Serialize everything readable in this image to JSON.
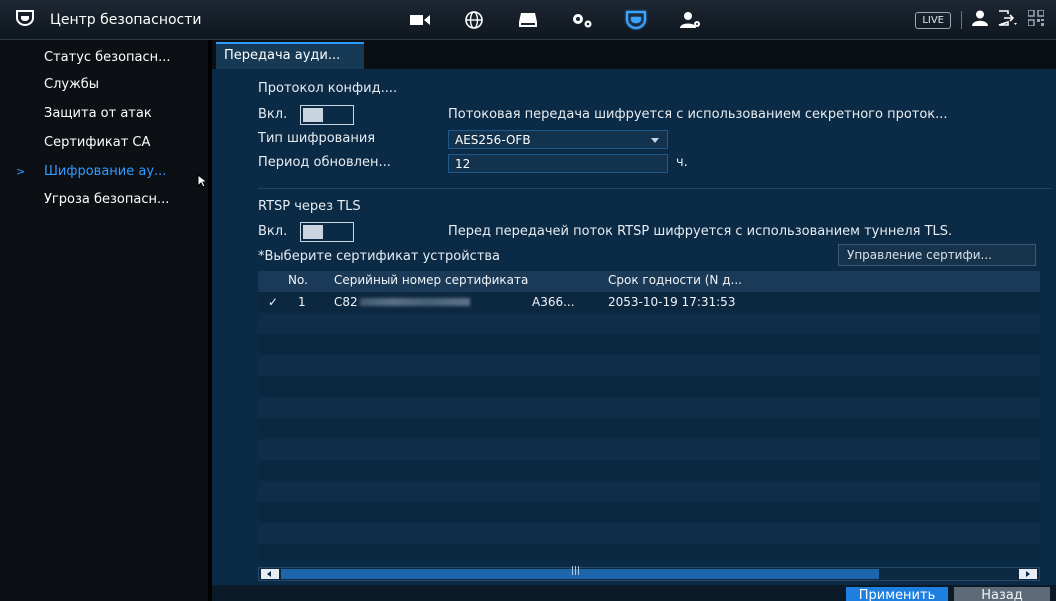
{
  "header": {
    "title": "Центр безопасности",
    "live_label": "LIVE",
    "nav_icons": [
      "camera-icon",
      "network-globe-icon",
      "storage-icon",
      "settings-gears-icon",
      "security-shield-icon",
      "account-icon"
    ]
  },
  "sidebar": {
    "items": [
      {
        "label": "Статус безопасн..."
      },
      {
        "label": "Службы"
      },
      {
        "label": "Защита от атак"
      },
      {
        "label": "Сертификат CA"
      },
      {
        "label": "Шифрование ау...",
        "active": true
      },
      {
        "label": "Угроза безопасн..."
      }
    ]
  },
  "tabs": [
    {
      "label": "Передача ауди..."
    }
  ],
  "form": {
    "section1_title": "Протокол конфид....",
    "enable1_label": "Вкл.",
    "enable1_desc": "Потоковая передача шифруется с использованием секретного проток...",
    "cipher_label": "Тип шифрования",
    "cipher_value": "AES256-OFB",
    "period_label": "Период обновлен...",
    "period_value": "12",
    "period_unit": "ч.",
    "section2_title": "RTSP через TLS",
    "enable2_label": "Вкл.",
    "enable2_desc": "Перед передачей поток RTSP шифруется с использованием туннеля TLS.",
    "cert_select_label": "*Выберите сертификат устройства",
    "cert_manage_button": "Управление сертифи..."
  },
  "table": {
    "headers": [
      "No.",
      "Серийный номер сертификата",
      "Срок годности (N д..."
    ],
    "rows": [
      {
        "check": "✓",
        "no": "1",
        "serial_start": "C82",
        "serial_end": "A366...",
        "expiry": "2053-10-19 17:31:53"
      }
    ]
  },
  "footer": {
    "apply_label": "Применить",
    "back_label": "Назад"
  },
  "colors": {
    "accent": "#2f9bff",
    "panel": "#0b2a45",
    "apply_button": "#1d7fe0"
  }
}
